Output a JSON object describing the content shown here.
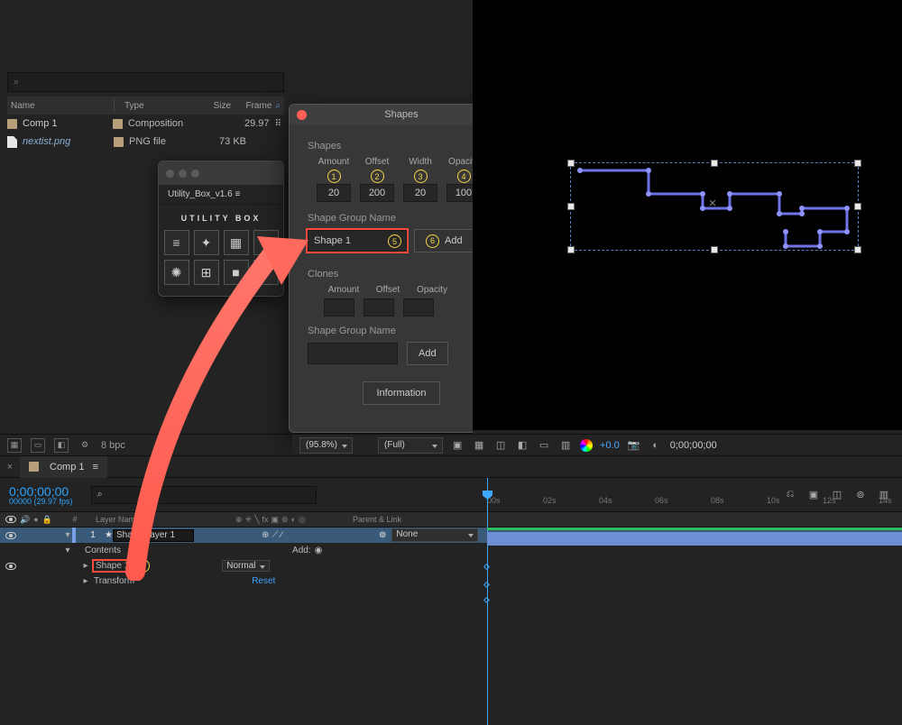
{
  "project": {
    "search_placeholder": "⌕",
    "columns": {
      "name": "Name",
      "type": "Type",
      "size": "Size",
      "frame": "Frame"
    },
    "rows": [
      {
        "name": "Comp 1",
        "type": "Composition",
        "size": "",
        "frame": "29.97",
        "color": "#b79f7c",
        "icon": "comp"
      },
      {
        "name": "nextist.png",
        "type": "PNG file",
        "size": "73 KB",
        "frame": "",
        "color": "#b79f7c",
        "icon": "file",
        "italic": true
      }
    ],
    "footer": {
      "bpc": "8 bpc"
    }
  },
  "utility_panel": {
    "tab_title": "Utility_Box_v1.6  ≡",
    "logo": "UTILITY BOX"
  },
  "shapes_window": {
    "title": "Shapes",
    "section_shapes": "Shapes",
    "params": {
      "amount": {
        "label": "Amount",
        "annot": "1",
        "value": "20"
      },
      "offset": {
        "label": "Offset",
        "annot": "2",
        "value": "200"
      },
      "width": {
        "label": "Width",
        "annot": "3",
        "value": "20"
      },
      "opacity": {
        "label": "Opacity",
        "annot": "4",
        "value": "100"
      }
    },
    "shape_group_label": "Shape Group Name",
    "shape_group_value": "Shape 1",
    "shape_group_annot": "5",
    "add_label": "Add",
    "add_annot": "6",
    "section_clones": "Clones",
    "clone_labels": {
      "amount": "Amount",
      "offset": "Offset",
      "opacity": "Opacity"
    },
    "clone_shape_group_label": "Shape Group Name",
    "clone_add_label": "Add",
    "info_label": "Information"
  },
  "viewer_footer": {
    "zoom": "(95.8%)",
    "res": "(Full)",
    "exposure": "+0.0",
    "timecode": "0;00;00;00"
  },
  "timeline": {
    "tab": "Comp 1",
    "timecode": "0;00;00;00",
    "timecode_sub": "00000 (29.97 fps)",
    "search_placeholder": "⌕",
    "columns": {
      "num": "#",
      "layer": "Layer Name",
      "parent": "Parent & Link"
    },
    "layer": {
      "index": "1",
      "name": "Shape Layer 1",
      "parent": "None"
    },
    "contents": "Contents",
    "add_label": "Add:",
    "shape1": "Shape 1",
    "shape1_annot": "5",
    "shape1_mode": "Normal",
    "transform": "Transform",
    "transform_reset": "Reset",
    "ruler": [
      "00s",
      "02s",
      "04s",
      "06s",
      "08s",
      "10s",
      "12s",
      "14s"
    ]
  }
}
